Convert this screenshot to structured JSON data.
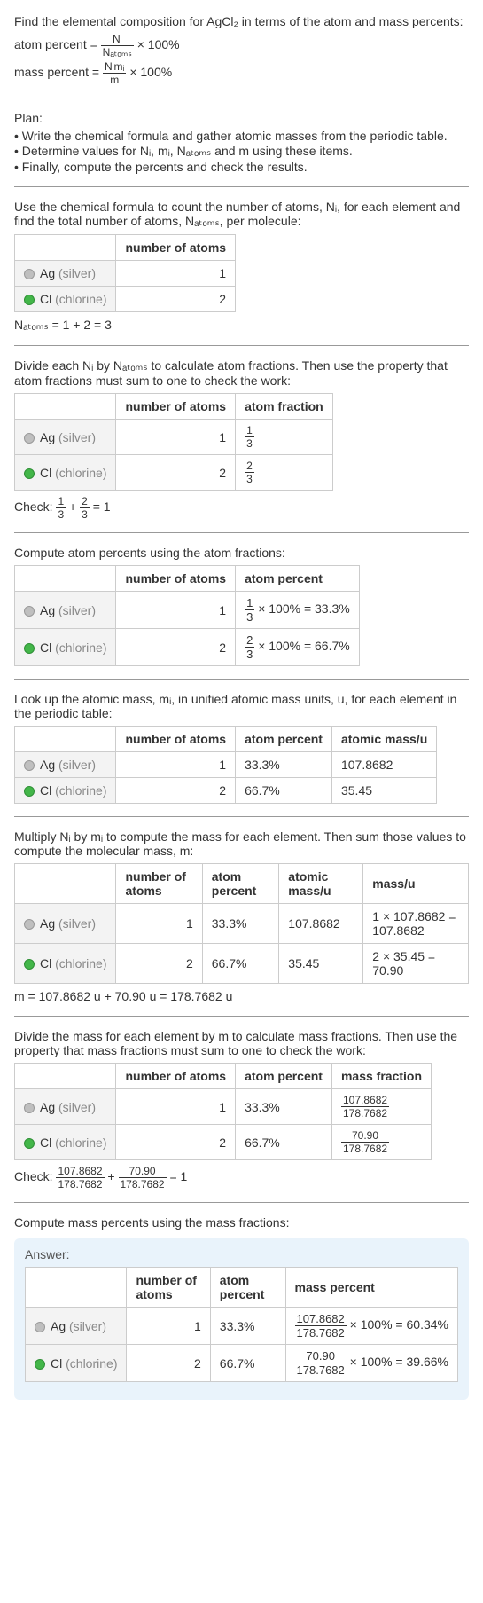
{
  "intro": {
    "line1": "Find the elemental composition for AgCl₂ in terms of the atom and mass percents:",
    "atom_percent_lhs": "atom percent =",
    "atom_percent_frac_num": "Nᵢ",
    "atom_percent_frac_den": "Nₐₜₒₘₛ",
    "atom_percent_rhs": "× 100%",
    "mass_percent_lhs": "mass percent =",
    "mass_percent_frac_num": "Nᵢmᵢ",
    "mass_percent_frac_den": "m",
    "mass_percent_rhs": "× 100%"
  },
  "plan": {
    "heading": "Plan:",
    "item1": "Write the chemical formula and gather atomic masses from the periodic table.",
    "item2": "Determine values for Nᵢ, mᵢ, Nₐₜₒₘₛ and m using these items.",
    "item3": "Finally, compute the percents and check the results."
  },
  "elements": {
    "ag_sym": "Ag",
    "ag_name": "(silver)",
    "cl_sym": "Cl",
    "cl_name": "(chlorine)"
  },
  "headers": {
    "number_of_atoms": "number of atoms",
    "atom_fraction": "atom fraction",
    "atom_percent": "atom percent",
    "atomic_mass_u": "atomic mass/u",
    "mass_u": "mass/u",
    "mass_fraction": "mass fraction",
    "mass_percent": "mass percent"
  },
  "section1": {
    "text": "Use the chemical formula to count the number of atoms, Nᵢ, for each element and find the total number of atoms, Nₐₜₒₘₛ, per molecule:",
    "ag_atoms": "1",
    "cl_atoms": "2",
    "sum": "Nₐₜₒₘₛ = 1 + 2 = 3"
  },
  "section2": {
    "text": "Divide each Nᵢ by Nₐₜₒₘₛ to calculate atom fractions. Then use the property that atom fractions must sum to one to check the work:",
    "ag_atoms": "1",
    "ag_frac_num": "1",
    "ag_frac_den": "3",
    "cl_atoms": "2",
    "cl_frac_num": "2",
    "cl_frac_den": "3",
    "check_lhs": "Check:",
    "check_f1_num": "1",
    "check_f1_den": "3",
    "check_plus": "+",
    "check_f2_num": "2",
    "check_f2_den": "3",
    "check_rhs": "= 1"
  },
  "section3": {
    "text": "Compute atom percents using the atom fractions:",
    "ag_atoms": "1",
    "ag_frac_num": "1",
    "ag_frac_den": "3",
    "ag_rhs": "× 100% = 33.3%",
    "cl_atoms": "2",
    "cl_frac_num": "2",
    "cl_frac_den": "3",
    "cl_rhs": "× 100% = 66.7%"
  },
  "section4": {
    "text": "Look up the atomic mass, mᵢ, in unified atomic mass units, u, for each element in the periodic table:",
    "ag_atoms": "1",
    "ag_pct": "33.3%",
    "ag_mass": "107.8682",
    "cl_atoms": "2",
    "cl_pct": "66.7%",
    "cl_mass": "35.45"
  },
  "section5": {
    "text": "Multiply Nᵢ by mᵢ to compute the mass for each element. Then sum those values to compute the molecular mass, m:",
    "ag_atoms": "1",
    "ag_pct": "33.3%",
    "ag_mass": "107.8682",
    "ag_calc": "1 × 107.8682 = 107.8682",
    "cl_atoms": "2",
    "cl_pct": "66.7%",
    "cl_mass": "35.45",
    "cl_calc": "2 × 35.45 = 70.90",
    "sum": "m = 107.8682 u + 70.90 u = 178.7682 u"
  },
  "section6": {
    "text": "Divide the mass for each element by m to calculate mass fractions. Then use the property that mass fractions must sum to one to check the work:",
    "ag_atoms": "1",
    "ag_pct": "33.3%",
    "ag_frac_num": "107.8682",
    "ag_frac_den": "178.7682",
    "cl_atoms": "2",
    "cl_pct": "66.7%",
    "cl_frac_num": "70.90",
    "cl_frac_den": "178.7682",
    "check_lhs": "Check:",
    "check_f1_num": "107.8682",
    "check_f1_den": "178.7682",
    "check_plus": "+",
    "check_f2_num": "70.90",
    "check_f2_den": "178.7682",
    "check_rhs": "= 1"
  },
  "section7": {
    "text": "Compute mass percents using the mass fractions:"
  },
  "answer": {
    "heading": "Answer:",
    "ag_atoms": "1",
    "ag_pct": "33.3%",
    "ag_frac_num": "107.8682",
    "ag_frac_den": "178.7682",
    "ag_rhs": "× 100% = 60.34%",
    "cl_atoms": "2",
    "cl_pct": "66.7%",
    "cl_frac_num": "70.90",
    "cl_frac_den": "178.7682",
    "cl_rhs": "× 100% = 39.66%"
  }
}
